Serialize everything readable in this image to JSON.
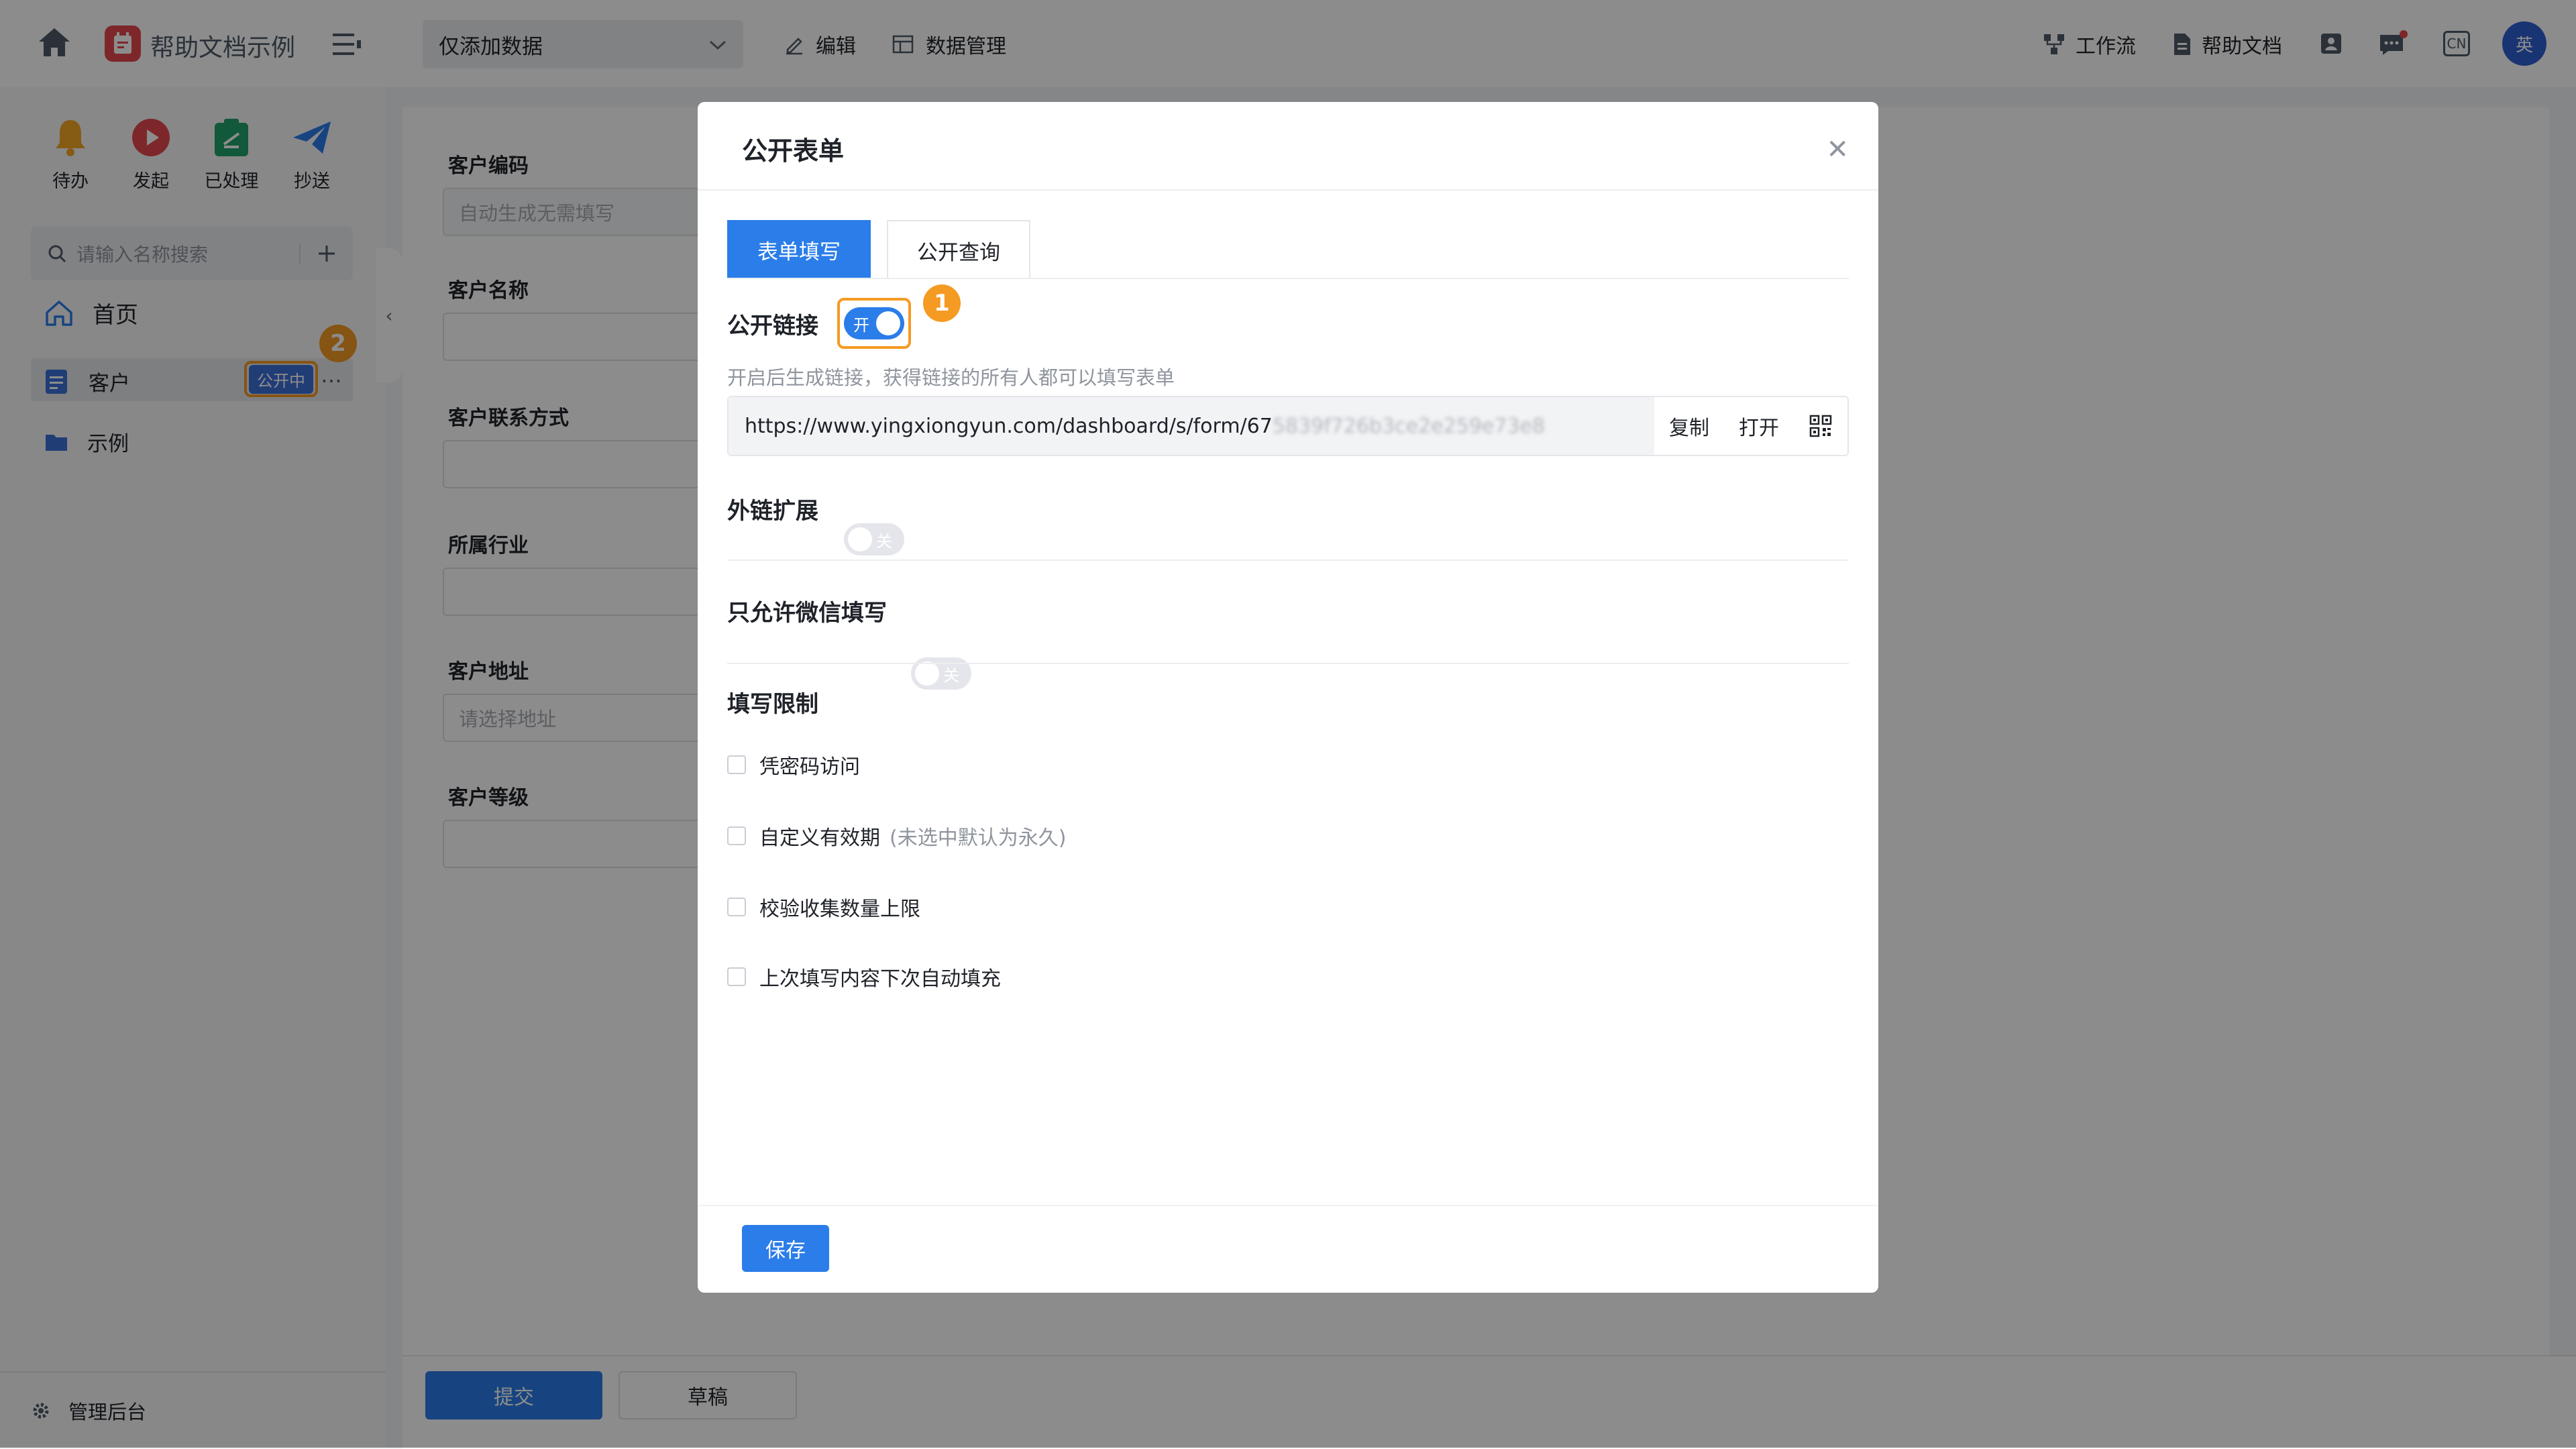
{
  "topbar": {
    "app_title": "帮助文档示例",
    "view_select": "仅添加数据",
    "edit_label": "编辑",
    "data_manage_label": "数据管理",
    "workflow_label": "工作流",
    "help_label": "帮助文档",
    "lang_label": "CN",
    "avatar_text": "英"
  },
  "sidebar": {
    "quick_actions": [
      {
        "label": "待办",
        "icon": "bell-icon"
      },
      {
        "label": "发起",
        "icon": "play-icon"
      },
      {
        "label": "已处理",
        "icon": "check-doc-icon"
      },
      {
        "label": "抄送",
        "icon": "send-icon"
      }
    ],
    "search_placeholder": "请输入名称搜索",
    "home_label": "首页",
    "items": [
      {
        "label": "客户",
        "badge": "公开中"
      },
      {
        "label": "示例"
      }
    ],
    "admin_label": "管理后台",
    "marker_2": "2"
  },
  "form": {
    "fields": [
      {
        "label": "客户编码",
        "placeholder": "自动生成无需填写"
      },
      {
        "label": "客户名称",
        "placeholder": ""
      },
      {
        "label": "客户联系方式",
        "placeholder": ""
      },
      {
        "label": "所属行业",
        "placeholder": ""
      },
      {
        "label": "客户地址",
        "placeholder": "请选择地址"
      },
      {
        "label": "客户等级",
        "placeholder": ""
      }
    ],
    "submit_label": "提交",
    "draft_label": "草稿"
  },
  "modal": {
    "title": "公开表单",
    "tabs": [
      "表单填写",
      "公开查询"
    ],
    "public_link_label": "公开链接",
    "public_link_switch": "开",
    "marker_1": "1",
    "public_link_hint": "开启后生成链接，获得链接的所有人都可以填写表单",
    "url_visible": "https://www.yingxiongyun.com/dashboard/s/form/67",
    "url_blurred": "5839f726b3ce2e259e73e8",
    "copy_label": "复制",
    "open_label": "打开",
    "ext_link_label": "外链扩展",
    "ext_switch": "关",
    "wechat_only_label": "只允许微信填写",
    "wechat_switch": "关",
    "limit_section": "填写限制",
    "limits": [
      {
        "label": "凭密码访问",
        "note": ""
      },
      {
        "label": "自定义有效期",
        "note": "(未选中默认为永久)"
      },
      {
        "label": "校验收集数量上限",
        "note": ""
      },
      {
        "label": "上次填写内容下次自动填充",
        "note": ""
      }
    ],
    "save_label": "保存"
  }
}
